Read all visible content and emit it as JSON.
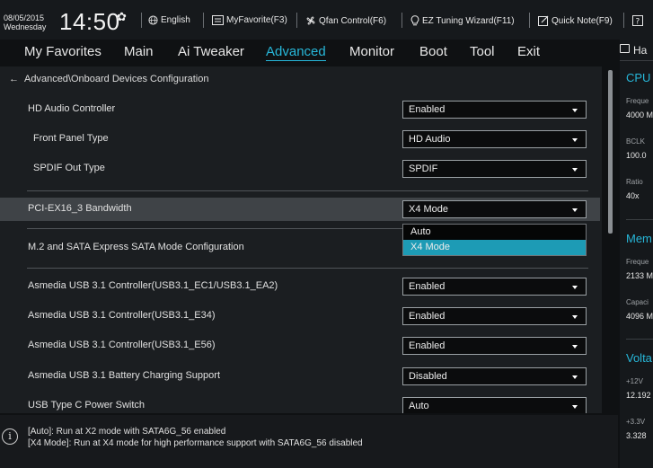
{
  "topbar": {
    "date": "08/05/2015",
    "day": "Wednesday",
    "time": "14:50",
    "language": "English",
    "my_favorite": "MyFavorite(F3)",
    "qfan": "Qfan Control(F6)",
    "ez_tuning": "EZ Tuning Wizard(F11)",
    "quick_note": "Quick Note(F9)"
  },
  "nav": {
    "tabs": [
      "My Favorites",
      "Main",
      "Ai Tweaker",
      "Advanced",
      "Monitor",
      "Boot",
      "Tool",
      "Exit"
    ],
    "active": "Advanced"
  },
  "breadcrumb": "Advanced\\Onboard Devices Configuration",
  "settings": [
    {
      "label": "HD Audio Controller",
      "value": "Enabled"
    },
    {
      "label": "Front Panel Type",
      "value": "HD Audio"
    },
    {
      "label": "SPDIF Out Type",
      "value": "SPDIF"
    },
    {
      "label": "PCI-EX16_3 Bandwidth",
      "value": "X4 Mode"
    },
    {
      "label": "M.2 and SATA Express SATA Mode Configuration",
      "value": ""
    },
    {
      "label": "Asmedia USB 3.1 Controller(USB3.1_EC1/USB3.1_EA2)",
      "value": "Enabled"
    },
    {
      "label": "Asmedia USB 3.1 Controller(USB3.1_E34)",
      "value": "Enabled"
    },
    {
      "label": "Asmedia USB 3.1 Controller(USB3.1_E56)",
      "value": "Enabled"
    },
    {
      "label": "Asmedia USB 3.1 Battery Charging Support",
      "value": "Disabled"
    },
    {
      "label": "USB Type C Power Switch",
      "value": "Auto"
    }
  ],
  "dropdown": {
    "options": [
      "Auto",
      "X4 Mode"
    ],
    "selected": "X4 Mode"
  },
  "help": {
    "line1": "[Auto]: Run at X2 mode with SATA6G_56 enabled",
    "line2": "[X4 Mode]: Run at X4 mode for high performance support with SATA6G_56 disabled"
  },
  "hw_monitor": {
    "title": "Ha",
    "cpu_title": "CPU",
    "freq_label": "Freque",
    "freq_value": "4000 M",
    "bclk_label": "BCLK",
    "bclk_value": "100.0",
    "ratio_label": "Ratio",
    "ratio_value": "40x",
    "mem_title": "Mem",
    "mem_freq_label": "Freque",
    "mem_freq_value": "2133 M",
    "cap_label": "Capaci",
    "cap_value": "4096 M",
    "volt_title": "Volta",
    "v12_label": "+12V",
    "v12_value": "12.192",
    "v33_label": "+3.3V",
    "v33_value": "3.328"
  },
  "colors": {
    "accent": "#27b7d9",
    "selected_option": "#1d9bb5",
    "background": "#1b1e21"
  },
  "icons": [
    "gear-icon",
    "globe-icon",
    "favorite-icon",
    "fan-icon",
    "bulb-icon",
    "note-icon",
    "back-arrow-icon",
    "caret-down-icon",
    "info-icon"
  ]
}
